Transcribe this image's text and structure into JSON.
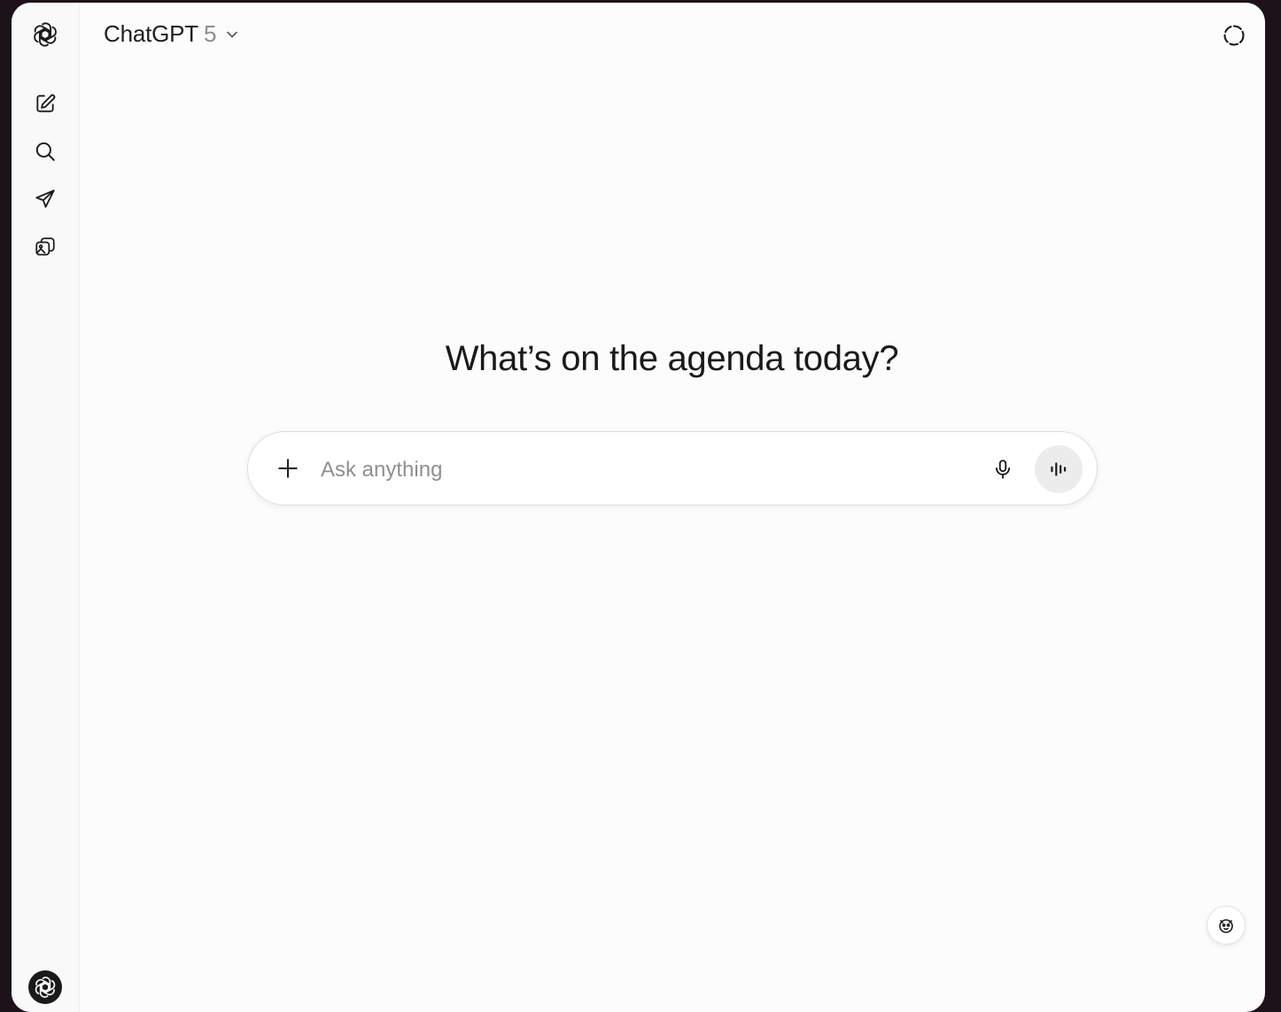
{
  "header": {
    "model_name": "ChatGPT",
    "model_version": "5"
  },
  "sidebar": {
    "items": [
      {
        "name": "new-chat",
        "icon": "compose-icon"
      },
      {
        "name": "search",
        "icon": "search-icon"
      },
      {
        "name": "send",
        "icon": "paper-plane-icon"
      },
      {
        "name": "library",
        "icon": "images-icon"
      }
    ]
  },
  "main": {
    "greeting": "What’s on the agenda today?"
  },
  "composer": {
    "placeholder": "Ask anything",
    "value": ""
  },
  "colors": {
    "background": "#fcfcfc",
    "sidebar": "#f9f9f9",
    "text": "#1a1a1a",
    "muted": "#8f8f8f",
    "voice_button": "#ececec"
  }
}
